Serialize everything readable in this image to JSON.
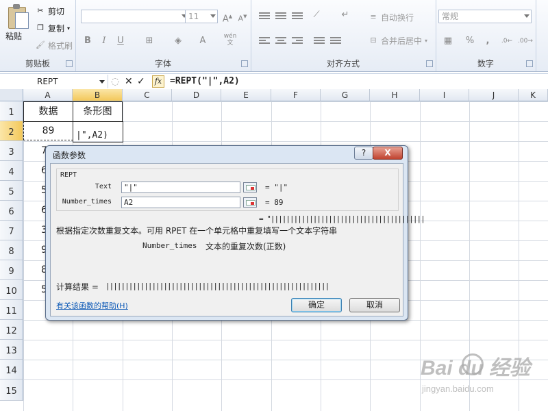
{
  "ribbon": {
    "clipboard": {
      "paste": "粘贴",
      "cut": "剪切",
      "copy": "复制",
      "format_painter": "格式刷",
      "group": "剪贴板"
    },
    "font": {
      "size": "11",
      "bold": "B",
      "italic": "I",
      "underline": "U",
      "grow": "A",
      "shrink": "A",
      "font_color": "A",
      "wen": "wén",
      "group": "字体"
    },
    "alignment": {
      "wrap": "自动换行",
      "merge": "合并后居中",
      "group": "对齐方式"
    },
    "number": {
      "format": "常规",
      "percent": "%",
      "comma": ",",
      "group": "数字"
    }
  },
  "formula_bar": {
    "name_box": "REPT",
    "cancel": "✕",
    "enter": "✓",
    "fx": "fx",
    "formula": "=REPT(\"|\",A2)"
  },
  "sheet": {
    "columns": [
      "A",
      "B",
      "C",
      "D",
      "E",
      "F",
      "G",
      "H",
      "I",
      "J",
      "K"
    ],
    "rows": [
      "1",
      "2",
      "3",
      "4",
      "5",
      "6",
      "7",
      "8",
      "9",
      "10",
      "11",
      "12",
      "13",
      "14",
      "15"
    ],
    "a1": "数据",
    "b1": "条形图",
    "a2": "89",
    "b2": "|\",A2)",
    "a_partial": [
      "7",
      "6",
      "5",
      "6",
      "3",
      "9",
      "8",
      "5"
    ]
  },
  "dialog": {
    "title": "函数参数",
    "help_button": "?",
    "close_button": "X",
    "function_name": "REPT",
    "args": [
      {
        "label": "Text",
        "value": "\"|\"",
        "result": "= \"|\""
      },
      {
        "label": "Number_times",
        "value": "A2",
        "result": "= 89"
      }
    ],
    "formula_result_preview": "= \"||||||||||||||||||||||||||||||||||||||||",
    "description": "根据指定次数重复文本。可用 RPET 在一个单元格中重复填写一个文本字符串",
    "arg_help_name": "Number_times",
    "arg_help_text": "文本的重复次数(正数)",
    "calc_label": "计算结果 =",
    "calc_value": "||||||||||||||||||||||||||||||||||||||||||||||||||||||||||",
    "help_link": "有关该函数的帮助(H)",
    "ok": "确定",
    "cancel": "取消"
  },
  "watermark": {
    "brand": "Bai du 经验",
    "url": "jingyan.baidu.com"
  }
}
